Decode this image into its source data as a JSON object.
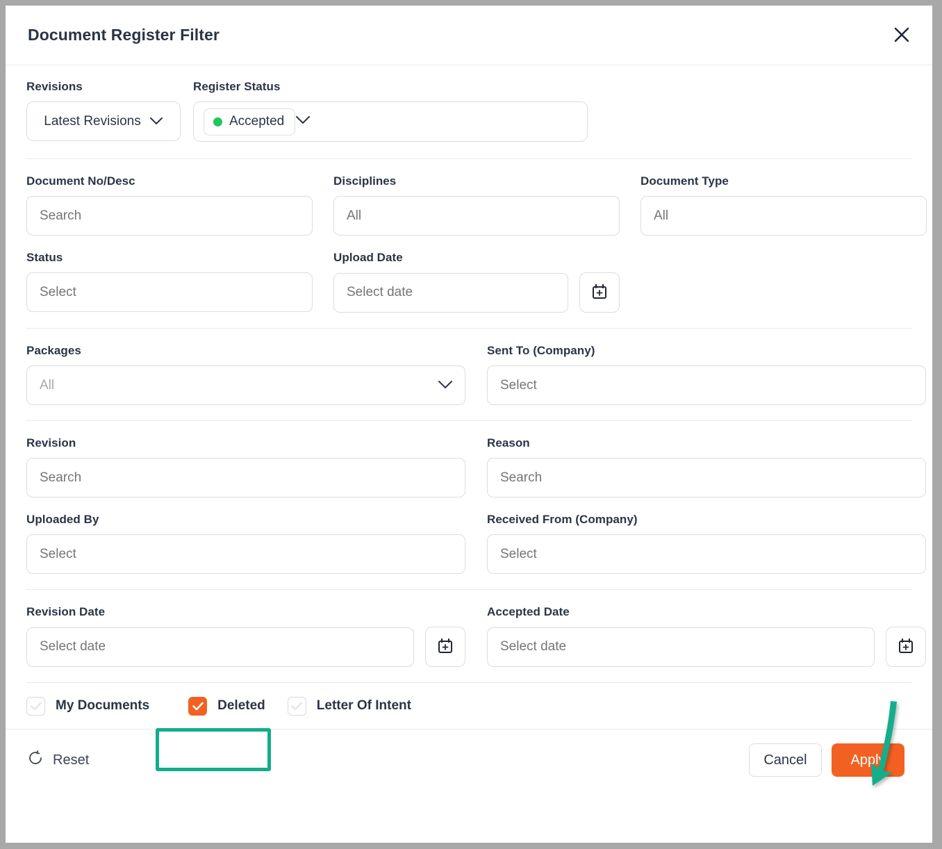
{
  "window": {
    "title": "Document Register Filter",
    "close_icon": "close-icon"
  },
  "colors": {
    "accent_orange": "#f26122",
    "status_green": "#22c55e",
    "annotation_teal": "#13ad8b",
    "text_dark": "#2b3445",
    "placeholder": "#a3a7ae",
    "border": "#dcdde1"
  },
  "top_row": {
    "revisions": {
      "label": "Revisions",
      "value": "Latest Revisions",
      "icon": "chevron-down-icon"
    },
    "register_status": {
      "label": "Register Status",
      "chips": [
        {
          "label": "Accepted",
          "dot_color": "#22c55e"
        }
      ],
      "icon": "chevron-down-icon"
    }
  },
  "fields": {
    "document_no_desc": {
      "label": "Document No/Desc",
      "placeholder": "Search",
      "value": ""
    },
    "disciplines": {
      "label": "Disciplines",
      "placeholder": "All",
      "value": ""
    },
    "document_type": {
      "label": "Document Type",
      "placeholder": "All",
      "value": ""
    },
    "status": {
      "label": "Status",
      "placeholder": "Select",
      "value": ""
    },
    "upload_date": {
      "label": "Upload Date",
      "placeholder": "Select date",
      "value": "",
      "icon": "calendar-plus-icon"
    },
    "packages": {
      "label": "Packages",
      "placeholder": "All",
      "value": "",
      "icon": "chevron-down-icon"
    },
    "sent_to_company": {
      "label": "Sent To (Company)",
      "placeholder": "Select",
      "value": ""
    },
    "revision": {
      "label": "Revision",
      "placeholder": "Search",
      "value": ""
    },
    "reason": {
      "label": "Reason",
      "placeholder": "Search",
      "value": ""
    },
    "uploaded_by": {
      "label": "Uploaded By",
      "placeholder": "Select",
      "value": ""
    },
    "received_from_company": {
      "label": "Received From (Company)",
      "placeholder": "Select",
      "value": ""
    },
    "revision_date": {
      "label": "Revision Date",
      "placeholder": "Select date",
      "value": "",
      "icon": "calendar-plus-icon"
    },
    "accepted_date": {
      "label": "Accepted Date",
      "placeholder": "Select date",
      "value": "",
      "icon": "calendar-plus-icon"
    }
  },
  "checkboxes": [
    {
      "label": "My Documents",
      "checked": false
    },
    {
      "label": "Deleted",
      "checked": true
    },
    {
      "label": "Letter Of Intent",
      "checked": false
    }
  ],
  "footer": {
    "reset_label": "Reset",
    "reset_icon": "rotate-ccw-icon",
    "cancel_label": "Cancel",
    "apply_label": "Apply"
  },
  "annotations": {
    "highlight_target": "Deleted",
    "arrow_target": "Apply"
  }
}
